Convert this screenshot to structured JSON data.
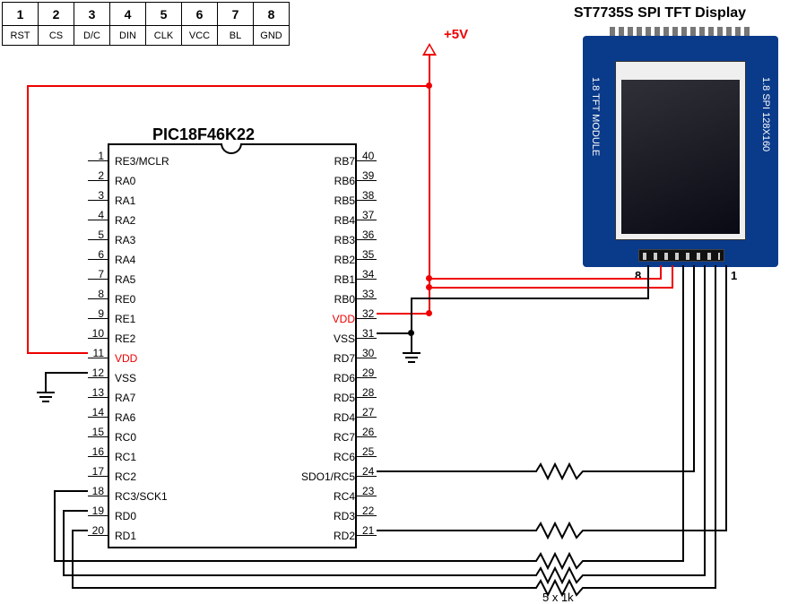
{
  "legend": {
    "nums": [
      "1",
      "2",
      "3",
      "4",
      "5",
      "6",
      "7",
      "8"
    ],
    "labels": [
      "RST",
      "CS",
      "D/C",
      "DIN",
      "CLK",
      "VCC",
      "BL",
      "GND"
    ]
  },
  "power_label": "+5V",
  "chip": {
    "name": "PIC18F46K22",
    "left": [
      {
        "n": "1",
        "lbl": "RE3/MCLR"
      },
      {
        "n": "2",
        "lbl": "RA0"
      },
      {
        "n": "3",
        "lbl": "RA1"
      },
      {
        "n": "4",
        "lbl": "RA2"
      },
      {
        "n": "5",
        "lbl": "RA3"
      },
      {
        "n": "6",
        "lbl": "RA4"
      },
      {
        "n": "7",
        "lbl": "RA5"
      },
      {
        "n": "8",
        "lbl": "RE0"
      },
      {
        "n": "9",
        "lbl": "RE1"
      },
      {
        "n": "10",
        "lbl": "RE2"
      },
      {
        "n": "11",
        "lbl": "VDD",
        "red": true
      },
      {
        "n": "12",
        "lbl": "VSS"
      },
      {
        "n": "13",
        "lbl": "RA7"
      },
      {
        "n": "14",
        "lbl": "RA6"
      },
      {
        "n": "15",
        "lbl": "RC0"
      },
      {
        "n": "16",
        "lbl": "RC1"
      },
      {
        "n": "17",
        "lbl": "RC2"
      },
      {
        "n": "18",
        "lbl": "RC3/SCK1"
      },
      {
        "n": "19",
        "lbl": "RD0"
      },
      {
        "n": "20",
        "lbl": "RD1"
      }
    ],
    "right": [
      {
        "n": "40",
        "lbl": "RB7"
      },
      {
        "n": "39",
        "lbl": "RB6"
      },
      {
        "n": "38",
        "lbl": "RB5"
      },
      {
        "n": "37",
        "lbl": "RB4"
      },
      {
        "n": "36",
        "lbl": "RB3"
      },
      {
        "n": "35",
        "lbl": "RB2"
      },
      {
        "n": "34",
        "lbl": "RB1"
      },
      {
        "n": "33",
        "lbl": "RB0"
      },
      {
        "n": "32",
        "lbl": "VDD",
        "red": true
      },
      {
        "n": "31",
        "lbl": "VSS"
      },
      {
        "n": "30",
        "lbl": "RD7"
      },
      {
        "n": "29",
        "lbl": "RD6"
      },
      {
        "n": "28",
        "lbl": "RD5"
      },
      {
        "n": "27",
        "lbl": "RD4"
      },
      {
        "n": "26",
        "lbl": "RC7"
      },
      {
        "n": "25",
        "lbl": "RC6"
      },
      {
        "n": "24",
        "lbl": "SDO1/RC5"
      },
      {
        "n": "23",
        "lbl": "RC4"
      },
      {
        "n": "22",
        "lbl": "RD3"
      },
      {
        "n": "21",
        "lbl": "RD2"
      }
    ]
  },
  "display": {
    "title": "ST7735S SPI TFT Display",
    "side_left": "1.8 TFT MODULE",
    "side_right": "1.8 SPI 128X160",
    "pin_left_mark": "8",
    "pin_right_mark": "1"
  },
  "resistor_label": "5 x 1k"
}
